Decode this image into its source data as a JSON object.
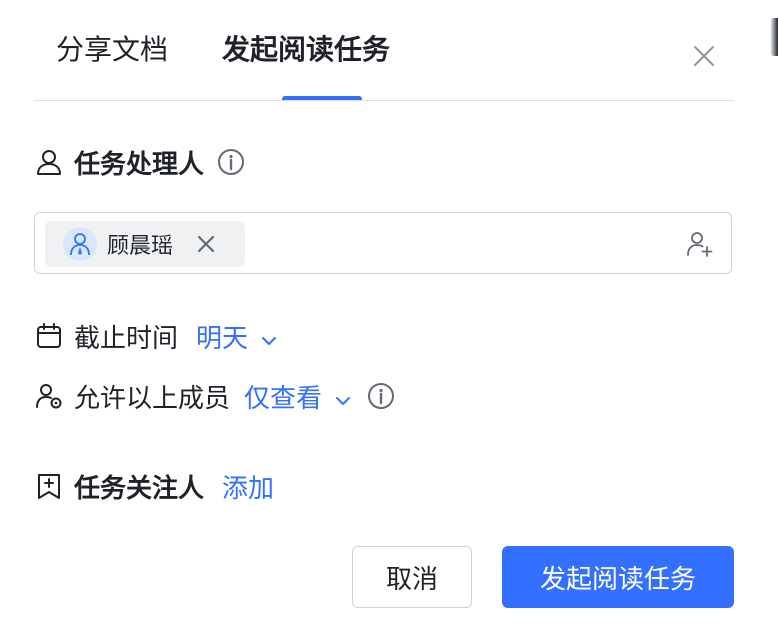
{
  "tabs": [
    {
      "label": "分享文档"
    },
    {
      "label": "发起阅读任务"
    }
  ],
  "assignee": {
    "label": "任务处理人",
    "members": [
      {
        "name": "顾晨瑶"
      }
    ]
  },
  "deadline": {
    "label": "截止时间",
    "value": "明天"
  },
  "permission": {
    "label": "允许以上成员",
    "value": "仅查看"
  },
  "followers": {
    "label": "任务关注人",
    "action": "添加"
  },
  "buttons": {
    "cancel": "取消",
    "submit": "发起阅读任务"
  },
  "colors": {
    "accent": "#3370ff",
    "text": "#1f2329",
    "muted": "#646a73"
  }
}
